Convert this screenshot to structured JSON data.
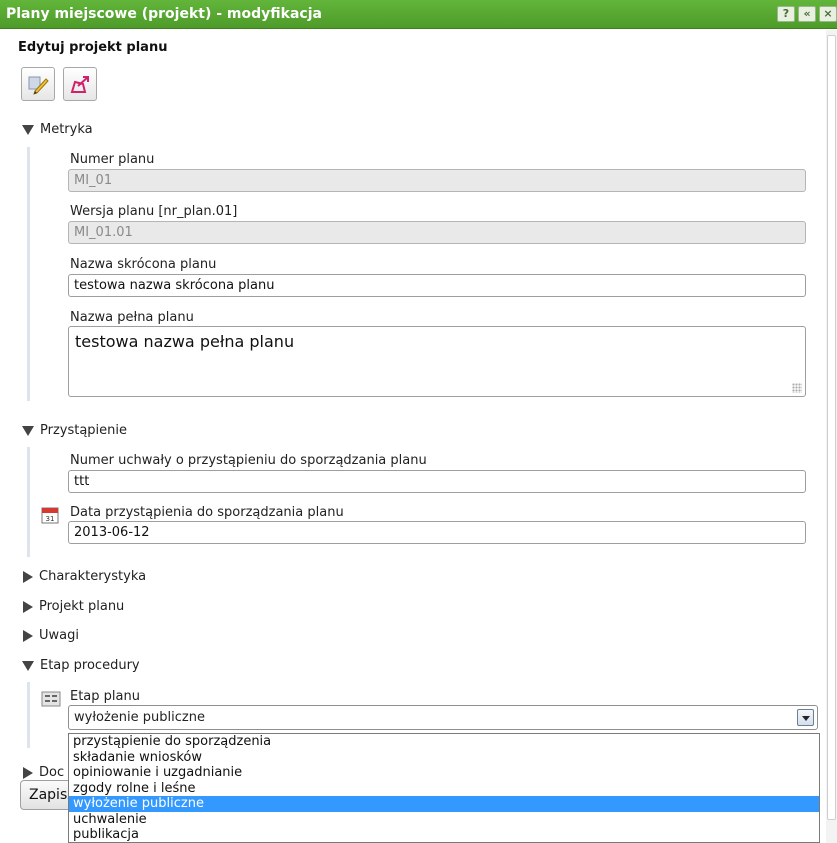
{
  "window": {
    "title": "Plany miejscowe (projekt) - modyfikacja",
    "help_label": "?",
    "collapse_label": "«",
    "close_label": "×"
  },
  "form": {
    "subtitle": "Edytuj projekt planu",
    "save_label": "Zapisz"
  },
  "icons": {
    "edit": "pencil-edit-icon",
    "export": "export-shape-icon",
    "calendar": "calendar-icon",
    "list": "list-icon"
  },
  "sections": {
    "metryka": {
      "title": "Metryka",
      "numer_planu": {
        "label": "Numer planu",
        "value": "MI_01"
      },
      "wersja_planu": {
        "label": "Wersja planu [nr_plan.01]",
        "value": "MI_01.01"
      },
      "nazwa_skrocona": {
        "label": "Nazwa skrócona planu",
        "value": "testowa nazwa skrócona planu"
      },
      "nazwa_pelna": {
        "label": "Nazwa pełna planu",
        "value": "testowa nazwa pełna planu"
      }
    },
    "przystapienie": {
      "title": "Przystąpienie",
      "numer_uchwaly": {
        "label": "Numer uchwały o przystąpieniu do sporządzania planu",
        "value": "ttt"
      },
      "data_przystapienia": {
        "label": "Data przystąpienia do sporządzania planu",
        "value": "2013-06-12"
      }
    },
    "charakterystyka": {
      "title": "Charakterystyka"
    },
    "projekt_planu": {
      "title": "Projekt planu"
    },
    "uwagi": {
      "title": "Uwagi"
    },
    "etap_procedury": {
      "title": "Etap procedury",
      "etap_planu": {
        "label": "Etap planu",
        "value": "wyłożenie publiczne",
        "options": [
          "przystąpienie do sporządzenia",
          "składanie wniosków",
          "opiniowanie i uzgadnianie",
          "zgody rolne i leśne",
          "wyłożenie publiczne",
          "uchwalenie",
          "publikacja"
        ],
        "selected_index": 4
      }
    },
    "dokumenty": {
      "title": "Doc"
    }
  },
  "colors": {
    "titlebar": "#55a730",
    "selected_option": "#3399ff"
  }
}
